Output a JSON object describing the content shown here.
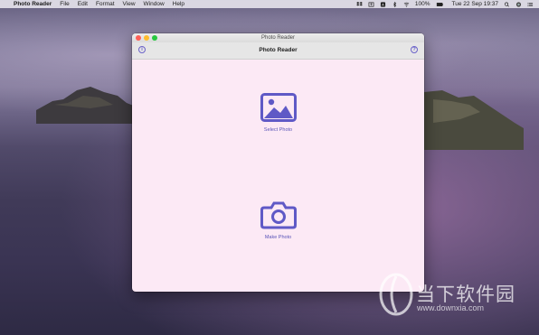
{
  "menubar": {
    "app_name": "Photo Reader",
    "menus": [
      "File",
      "Edit",
      "Format",
      "View",
      "Window",
      "Help"
    ],
    "battery": "100%",
    "datetime": "Tue 22 Sep  19:37"
  },
  "window": {
    "title": "Photo Reader",
    "toolbar_title": "Photo Reader",
    "select_label": "Select Photo",
    "make_label": "Make Photo",
    "accent_color": "#5f59c6",
    "background_color": "#fce9f5"
  },
  "watermark": {
    "text": "当下软件园",
    "url": "www.downxia.com"
  }
}
